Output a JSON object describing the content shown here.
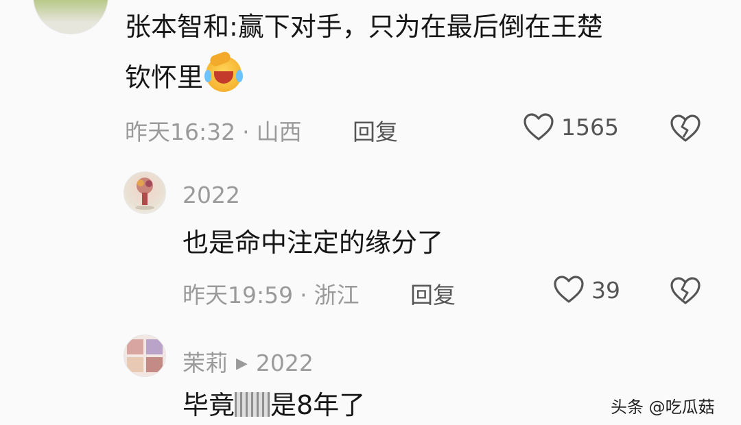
{
  "comments": [
    {
      "text_line1": "张本智和:赢下对手，只为在最后倒在王楚",
      "text_line2": "钦怀里",
      "emoji": "rolling-laughing-emoji",
      "time": "昨天16:32",
      "location": "山西",
      "reply_label": "回复",
      "likes": "1565"
    },
    {
      "username": "2022",
      "text": "也是命中注定的缘分了",
      "time": "昨天19:59",
      "location": "浙江",
      "reply_label": "回复",
      "likes": "39"
    },
    {
      "username": "茉莉",
      "reply_to": "2022",
      "text_start": "毕竟",
      "text_end": "是8年了"
    }
  ],
  "separator": "·",
  "watermark": "头条 @吃瓜菇",
  "icons": {
    "like": "heart-outline-icon",
    "dislike": "broken-heart-icon",
    "reply_arrow": "play-triangle-icon"
  },
  "colors": {
    "text": "#161616",
    "meta": "#9a9a9a",
    "background": "#fafafa"
  }
}
